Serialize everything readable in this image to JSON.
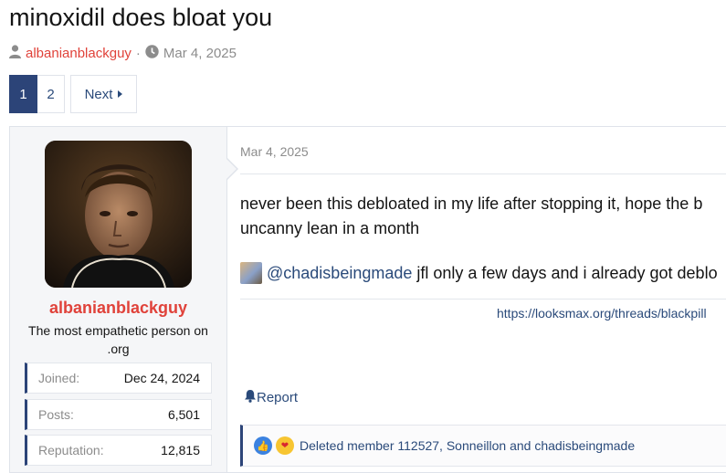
{
  "thread": {
    "title": "minoxidil does bloat you",
    "author": "albanianblackguy",
    "separator": "·",
    "date": "Mar 4, 2025"
  },
  "pagination": {
    "pages": [
      "1",
      "2"
    ],
    "current": "1",
    "next_label": "Next"
  },
  "user": {
    "name": "albanianblackguy",
    "title": "The most empathetic person on .org",
    "stats": [
      {
        "key": "Joined:",
        "value": "Dec 24, 2024"
      },
      {
        "key": "Posts:",
        "value": "6,501"
      },
      {
        "key": "Reputation:",
        "value": "12,815"
      }
    ]
  },
  "post": {
    "date": "Mar 4, 2025",
    "line1": "never been this debloated in my life after stopping it, hope the b",
    "line2": "uncanny lean in a month",
    "mention": "@chadisbeingmade",
    "mention_text": "jfl only a few days and i already got deblo",
    "link": "https://looksmax.org/threads/blackpill",
    "report_label": "Report",
    "reactions_text": "Deleted member 112527, Sonneillon and chadisbeingmade"
  },
  "icons": {
    "user": "user-icon",
    "clock": "clock-icon",
    "bell": "bell-icon",
    "like": "like-reaction-icon",
    "love": "love-reaction-icon"
  },
  "colors": {
    "accent": "#2c4478",
    "username": "#e0423a",
    "link": "#2a4a7a"
  }
}
